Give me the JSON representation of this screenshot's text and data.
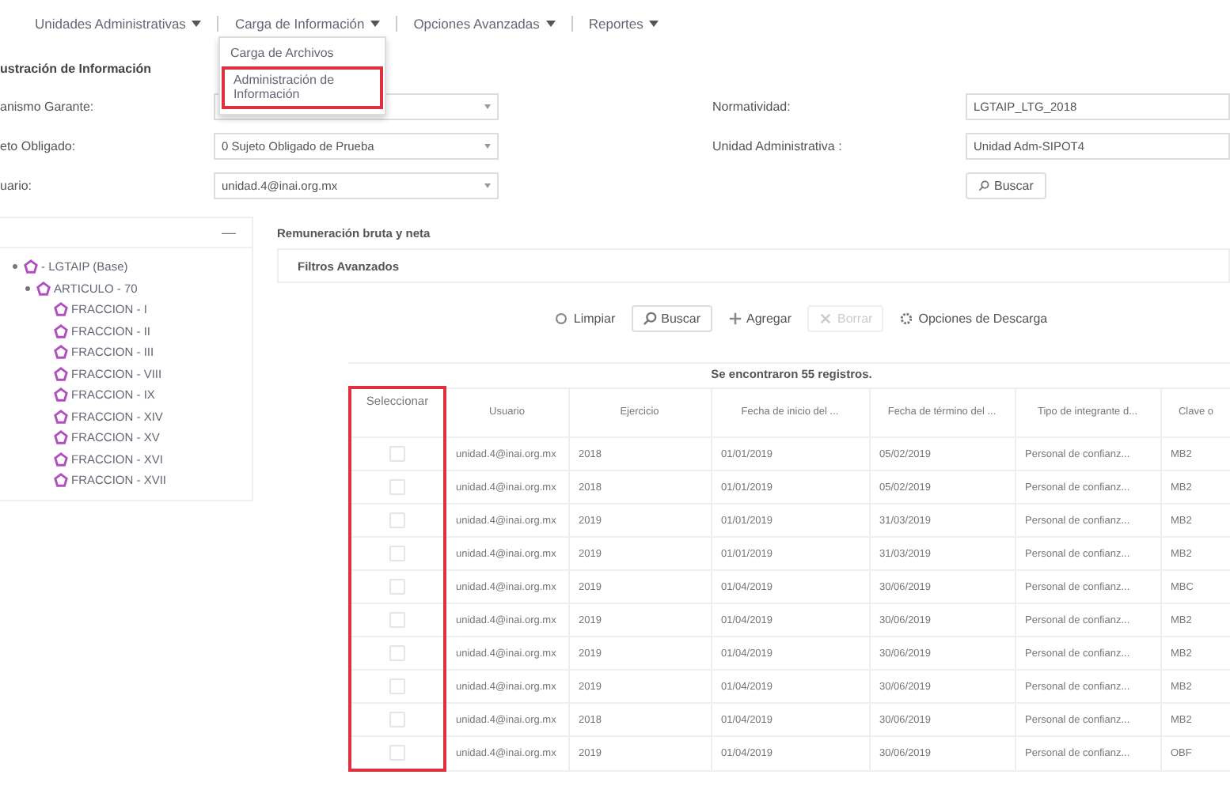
{
  "nav": {
    "menus": [
      {
        "label": "Unidades Administrativas"
      },
      {
        "label": "Carga de Información",
        "items": [
          {
            "label": "Carga de Archivos",
            "highlighted": false
          },
          {
            "label": "Administración de Información",
            "highlighted": true
          }
        ]
      },
      {
        "label": "Opciones Avanzadas"
      },
      {
        "label": "Reportes"
      }
    ]
  },
  "section_title": "ustración de Información",
  "form": {
    "left": [
      {
        "label": "anismo Garante:"
      },
      {
        "label": "eto Obligado:",
        "value": "0 Sujeto Obligado de Prueba"
      },
      {
        "label": "uario:",
        "value": "unidad.4@inai.org.mx"
      }
    ],
    "right": [
      {
        "label": "Normatividad:",
        "value": "LGTAIP_LTG_2018"
      },
      {
        "label": "Unidad Administrativa :",
        "value": "Unidad Adm-SIPOT4"
      }
    ],
    "search_button": "Buscar"
  },
  "tree": {
    "collapse": "—",
    "nodes": [
      {
        "label": "- LGTAIP (Base)",
        "children": [
          {
            "label": "ARTICULO - 70",
            "children": [
              {
                "label": "FRACCION - I"
              },
              {
                "label": "FRACCION - II"
              },
              {
                "label": "FRACCION - III"
              },
              {
                "label": "FRACCION - VIII"
              },
              {
                "label": "FRACCION - IX"
              },
              {
                "label": "FRACCION - XIV"
              },
              {
                "label": "FRACCION - XV"
              },
              {
                "label": "FRACCION - XVI"
              },
              {
                "label": "FRACCION - XVII"
              }
            ]
          }
        ]
      }
    ]
  },
  "report_title": "Remuneración bruta y neta",
  "filters_title": "Filtros Avanzados",
  "actions": [
    {
      "label": "Limpiar",
      "kind": "clear",
      "disabled": false
    },
    {
      "label": "Buscar",
      "kind": "search",
      "disabled": false
    },
    {
      "label": "Agregar",
      "kind": "add",
      "disabled": false
    },
    {
      "label": "Borrar",
      "kind": "delete",
      "disabled": true
    },
    {
      "label": "Opciones de Descarga",
      "kind": "options",
      "disabled": false
    }
  ],
  "table": {
    "caption": "Se encontraron 55 registros.",
    "select_column": {
      "label": "Seleccionar",
      "highlighted": true
    },
    "columns": [
      {
        "label": "Usuario",
        "highlighted": false
      },
      {
        "label": "Ejercicio",
        "highlighted": false
      },
      {
        "label": "Fecha de inicio del ...",
        "highlighted": false
      },
      {
        "label": "Fecha de término del ...",
        "highlighted": false
      },
      {
        "label": "Tipo de integrante d...",
        "highlighted": false
      },
      {
        "label": "Clave o",
        "highlighted": false
      }
    ],
    "rows": [
      {
        "checked": false,
        "cells": [
          "unidad.4@inai.org.mx",
          "2018",
          "01/01/2019",
          "05/02/2019",
          "Personal de confianz...",
          "MB2"
        ]
      },
      {
        "checked": false,
        "cells": [
          "unidad.4@inai.org.mx",
          "2018",
          "01/01/2019",
          "05/02/2019",
          "Personal de confianz...",
          "MB2"
        ]
      },
      {
        "checked": false,
        "cells": [
          "unidad.4@inai.org.mx",
          "2019",
          "01/01/2019",
          "31/03/2019",
          "Personal de confianz...",
          "MB2"
        ]
      },
      {
        "checked": false,
        "cells": [
          "unidad.4@inai.org.mx",
          "2019",
          "01/01/2019",
          "31/03/2019",
          "Personal de confianz...",
          "MB2"
        ]
      },
      {
        "checked": false,
        "cells": [
          "unidad.4@inai.org.mx",
          "2019",
          "01/04/2019",
          "30/06/2019",
          "Personal de confianz...",
          "MBC"
        ]
      },
      {
        "checked": false,
        "cells": [
          "unidad.4@inai.org.mx",
          "2019",
          "01/04/2019",
          "30/06/2019",
          "Personal de confianz...",
          "MB2"
        ]
      },
      {
        "checked": false,
        "cells": [
          "unidad.4@inai.org.mx",
          "2019",
          "01/04/2019",
          "30/06/2019",
          "Personal de confianz...",
          "MB2"
        ]
      },
      {
        "checked": false,
        "cells": [
          "unidad.4@inai.org.mx",
          "2019",
          "01/04/2019",
          "30/06/2019",
          "Personal de confianz...",
          "MB2"
        ]
      },
      {
        "checked": false,
        "cells": [
          "unidad.4@inai.org.mx",
          "2018",
          "01/04/2019",
          "30/06/2019",
          "Personal de confianz...",
          "MB2"
        ]
      },
      {
        "checked": false,
        "cells": [
          "unidad.4@inai.org.mx",
          "2019",
          "01/04/2019",
          "30/06/2019",
          "Personal de confianz...",
          "OBF"
        ]
      }
    ]
  }
}
